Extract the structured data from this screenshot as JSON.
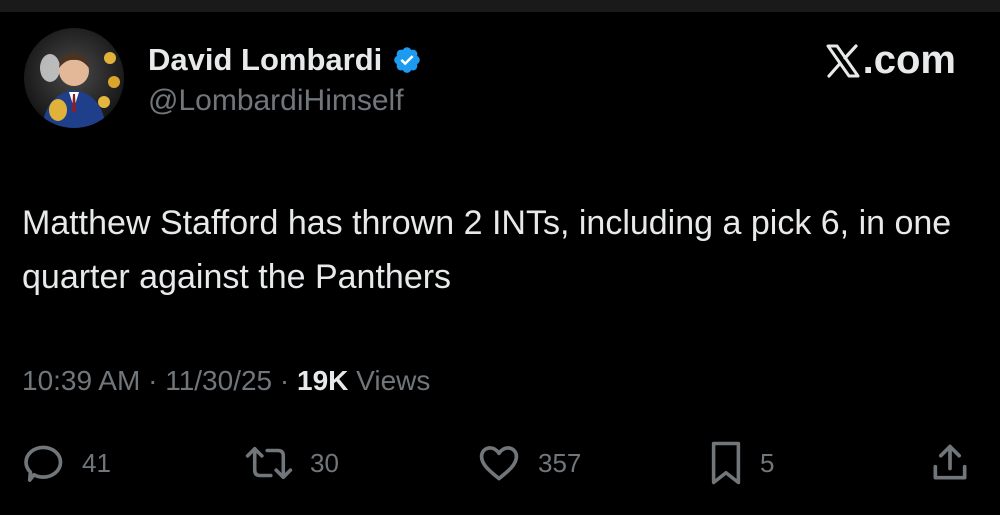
{
  "author": {
    "display_name": "David Lombardi",
    "handle": "@LombardiHimself",
    "verified": true
  },
  "brand": {
    "label": ".com",
    "icon": "x-logo-icon"
  },
  "tweet": {
    "text": "Matthew Stafford has thrown 2 INTs, including a pick 6, in one quarter against the Panthers",
    "time": "10:39 AM",
    "date": "11/30/25",
    "separator": "·",
    "views_count": "19K",
    "views_label": "Views"
  },
  "actions": {
    "replies": "41",
    "reposts": "30",
    "likes": "357",
    "bookmarks": "5"
  },
  "colors": {
    "background": "#000000",
    "primary_text": "#e7e9ea",
    "secondary_text": "#71767b",
    "verified_badge": "#1d9bf0"
  }
}
